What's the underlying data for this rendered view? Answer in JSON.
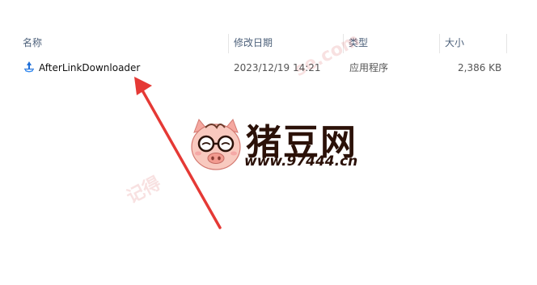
{
  "columns": {
    "name": "名称",
    "modified": "修改日期",
    "type": "类型",
    "size": "大小"
  },
  "files": [
    {
      "name": "AfterLinkDownloader",
      "modified": "2023/12/19 14:21",
      "type": "应用程序",
      "size": "2,386 KB",
      "icon": "app-icon"
    }
  ],
  "watermark": {
    "brand": "猪豆网",
    "url": "www.97444.cn",
    "left_text": "记得",
    "tail_text": "se.com",
    "logo": "pig-with-glasses-logo",
    "color": "#e07070"
  },
  "annotation": {
    "arrow_color": "#e53935"
  }
}
